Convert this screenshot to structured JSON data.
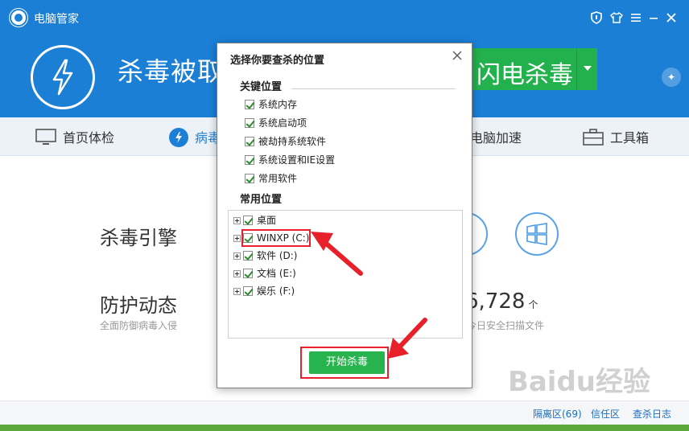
{
  "app": {
    "title": "电脑管家"
  },
  "hero": {
    "status_text": "杀毒被取",
    "scan_button_label": "闪电杀毒"
  },
  "nav": {
    "items": [
      {
        "label": "首页体检",
        "icon": "monitor-icon"
      },
      {
        "label": "病毒",
        "icon": "bolt-icon"
      },
      {
        "label": "电脑加速",
        "icon": "speed-icon"
      },
      {
        "label": "工具箱",
        "icon": "toolbox-icon"
      }
    ]
  },
  "content": {
    "engine_label": "杀毒引擎",
    "protect_label": "防护动态",
    "protect_sub": "全面防御病毒入侵",
    "scan_count": "6,728",
    "scan_count_unit": "个",
    "scan_count_sub": "今日安全扫描文件"
  },
  "footer": {
    "quarantine": "隔离区(69)",
    "trust": "信任区",
    "log": "查杀日志"
  },
  "watermark": "Baidu经验",
  "dialog": {
    "title": "选择你要查杀的位置",
    "key_section": "关键位置",
    "key_items": [
      "系统内存",
      "系统启动项",
      "被劫持系统软件",
      "系统设置和IE设置",
      "常用软件"
    ],
    "common_section": "常用位置",
    "tree_items": [
      "桌面",
      "WINXP (C:)",
      "软件 (D:)",
      "文档 (E:)",
      "娱乐 (F:)"
    ],
    "start_button": "开始杀毒"
  },
  "colors": {
    "brand_blue": "#1b7fd6",
    "accent_green": "#27b34d",
    "highlight_red": "#e8202a"
  }
}
